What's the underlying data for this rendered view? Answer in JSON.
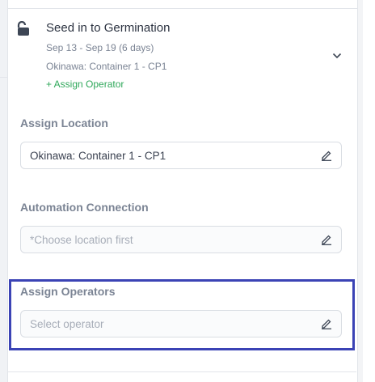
{
  "task": {
    "title": "Seed in to Germination",
    "dates": "Sep 13 - Sep 19 (6 days)",
    "location": "Okinawa: Container 1 - CP1",
    "assign_operator_link": "+ Assign Operator"
  },
  "assign_location": {
    "label": "Assign Location",
    "value": "Okinawa:  Container 1 -  CP1"
  },
  "automation_connection": {
    "label": "Automation Connection",
    "placeholder": "*Choose location first"
  },
  "assign_operators": {
    "label": "Assign Operators",
    "placeholder": "Select operator"
  },
  "icons": {
    "lock": "unlocked-padlock-icon",
    "chevron": "chevron-down-icon",
    "edit": "pencil-icon"
  },
  "colors": {
    "link_green": "#2fa85a",
    "highlight_blue": "#3b43b5",
    "label_gray": "#7b8494"
  }
}
